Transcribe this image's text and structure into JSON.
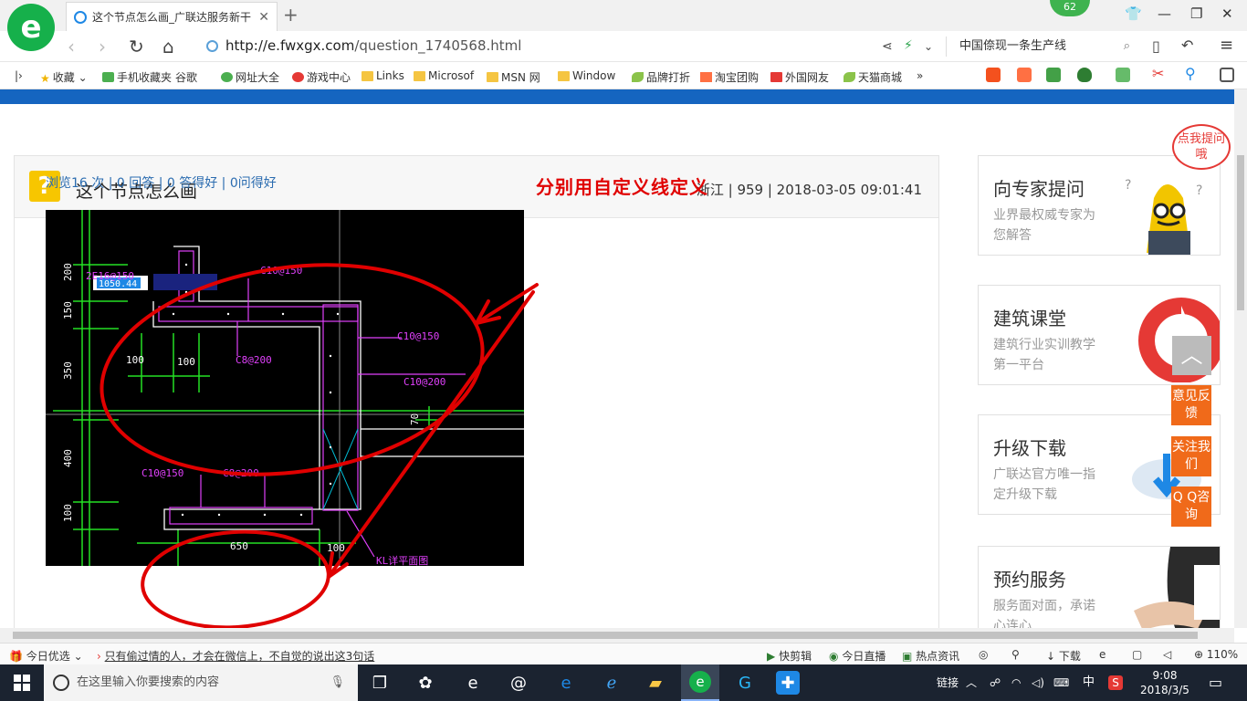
{
  "browser": {
    "tab_title": "这个节点怎么画_广联达服务新干",
    "badge_count": "62",
    "url_host": "http://e.fwxgx.com",
    "url_path": "/question_1740568.html",
    "search_text": "中国倷现一条生产线",
    "bookmarks": [
      "收藏",
      "手机收藏夹",
      "谷歌",
      "网址大全",
      "游戏中心",
      "Links",
      "Microsof",
      "MSN 网",
      "Window",
      "品牌打折",
      "淘宝团购",
      "外国网友",
      "天猫商城"
    ]
  },
  "question": {
    "title": "这个节点怎么画",
    "meta": "浙江 | 959 | 2018-03-05 09:01:41",
    "stats": "浏览16 次 | 0 回答 | 0 答得好 | 0问得好",
    "annotation": "分别用自定义线定义"
  },
  "cad": {
    "input_value": "1050.44",
    "labels": {
      "c10_150_a": "C10@150",
      "c10_150_b": "C10@150",
      "c10_200": "C10@200",
      "c8_200_a": "C8@200",
      "c8_200_b": "C8@200",
      "c10_150_c": "C10@150",
      "rebar": "2E16@150",
      "d100a": "100",
      "d100b": "100",
      "d100c": "100",
      "d650": "650",
      "d70": "70",
      "v200": "200",
      "v150": "150",
      "v350": "350",
      "v400": "400",
      "v100": "100",
      "kl": "KL详平面图"
    }
  },
  "sidebar": {
    "bubble": "点我提问哦",
    "cards": [
      {
        "title": "向专家提问",
        "desc": "业界最权威专家为您解答"
      },
      {
        "title": "建筑课堂",
        "desc": "建筑行业实训教学第一平台"
      },
      {
        "title": "升级下载",
        "desc": "广联达官方唯一指定升级下载"
      },
      {
        "title": "预约服务",
        "desc": "服务面对面，承诺心连心"
      }
    ],
    "float_buttons": [
      "意见反馈",
      "关注我们",
      "Q Q咨询"
    ]
  },
  "statusbar": {
    "today": "今日优选",
    "news": "只有偷过情的人，才会在微信上，不自觉的说出这3句话",
    "items": [
      "快剪辑",
      "今日直播",
      "热点资讯",
      "下载"
    ],
    "zoom": "110%"
  },
  "taskbar": {
    "search_placeholder": "在这里输入你要搜索的内容",
    "link": "链接",
    "ime": "中",
    "time": "9:08",
    "date": "2018/3/5"
  },
  "colors": {
    "annotation_red": "#e00000",
    "brand_blue": "#1565c0",
    "float_orange": "#f06a1a"
  }
}
